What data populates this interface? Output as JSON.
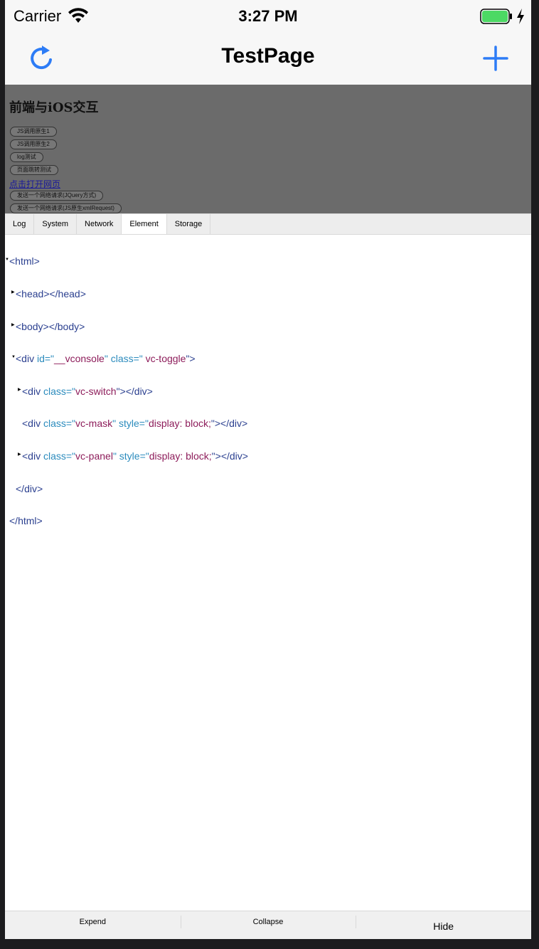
{
  "status_bar": {
    "carrier": "Carrier",
    "time": "3:27 PM"
  },
  "nav": {
    "title": "TestPage",
    "refresh_icon": "refresh-icon",
    "add_icon": "plus-icon"
  },
  "webpage": {
    "title": "前端与iOS交互",
    "buttons": [
      "JS调用原生1",
      "JS调用原生2",
      "log测试",
      "页面跳转测试"
    ],
    "link": "点击打开网页",
    "request_buttons": [
      "发送一个网络请求(JQuery方式)",
      "发送一个网络请求(JS原生xmlRequest)"
    ]
  },
  "vconsole": {
    "tabs": [
      "Log",
      "System",
      "Network",
      "Element",
      "Storage"
    ],
    "active_tab": "Element",
    "tree": {
      "html_open": "<html>",
      "head": "<head></head>",
      "body": "<body></body>",
      "div_open_start": "<div ",
      "id_attr": "id=\"",
      "id_val": "__vconsole",
      "class_attr": "\" class=\"",
      "class_val": " vc-toggle",
      "div_open_end": "\">",
      "switch_start": "<div ",
      "switch_class_attr": "class=\"",
      "switch_class_val": "vc-switch",
      "switch_end": "\"></div>",
      "mask_start": "<div ",
      "mask_class_attr": "class=\"",
      "mask_class_val": "vc-mask",
      "mask_style_attr": "\" style=\"",
      "mask_style_val": "display: block;",
      "mask_end": "\"></div>",
      "panel_start": "<div ",
      "panel_class_attr": "class=\"",
      "panel_class_val": "vc-panel",
      "panel_style_attr": "\" style=\"",
      "panel_style_val": "display: block;",
      "panel_end": "\"></div>",
      "div_close": "</div>",
      "html_close": "</html>"
    },
    "toolbar": {
      "expend": "Expend",
      "collapse": "Collapse",
      "hide": "Hide"
    }
  },
  "colors": {
    "accent": "#2d7cf6",
    "battery": "#4cd964"
  }
}
